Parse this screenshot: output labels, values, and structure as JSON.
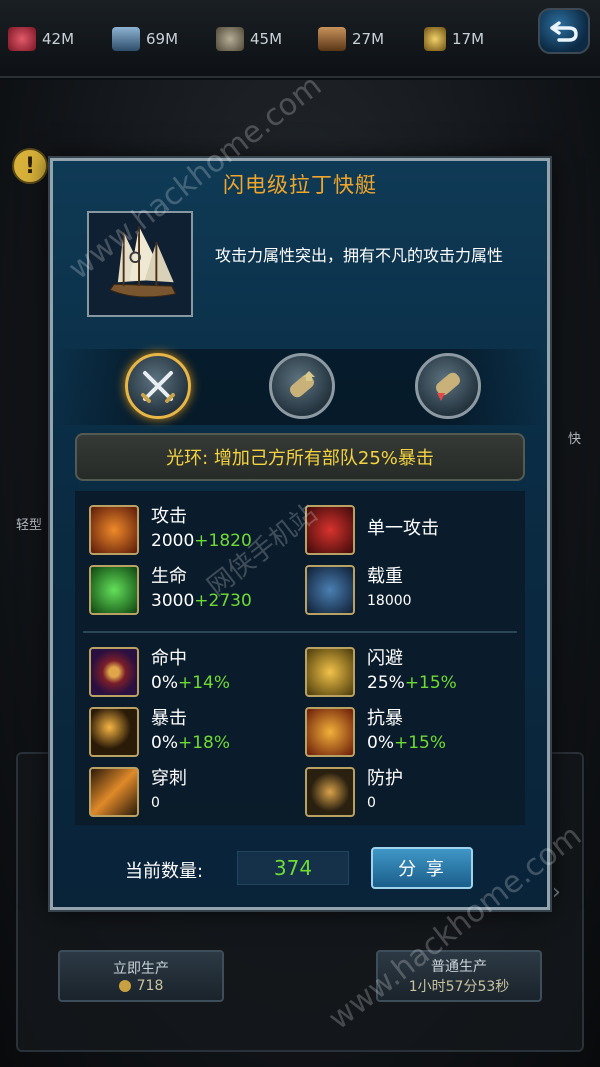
{
  "resources": [
    {
      "icon": "ruby-icon",
      "value": "42M",
      "color": "#c0354a"
    },
    {
      "icon": "steel-icon",
      "value": "69M",
      "color": "#4d7aa3"
    },
    {
      "icon": "stone-icon",
      "value": "45M",
      "color": "#8a7f6b"
    },
    {
      "icon": "wood-icon",
      "value": "27M",
      "color": "#9b6b3a"
    },
    {
      "icon": "gold-figure-icon",
      "value": "17M",
      "color": "#c9a03a"
    }
  ],
  "background": {
    "left_label": "轻型",
    "right_label": "快",
    "instant_btn": {
      "label": "立即生产",
      "cost": "718"
    },
    "normal_btn": {
      "label": "普通生产",
      "time": "1小时57分53秒"
    }
  },
  "dialog": {
    "title": "闪电级拉丁快艇",
    "description": "攻击力属性突出，拥有不凡的攻击力属性",
    "tabs": [
      {
        "icon": "crossed-swords-icon",
        "active": true
      },
      {
        "icon": "scroll-up-icon",
        "active": false
      },
      {
        "icon": "scroll-down-icon",
        "active": false
      }
    ],
    "aura": "光环: 增加己方所有部队25%暴击",
    "stats": [
      {
        "name": "攻击",
        "base": "2000",
        "bonus": "+1820",
        "icon": "attack-icon"
      },
      {
        "name": "单一攻击",
        "base": "",
        "bonus": "",
        "icon": "single-attack-icon"
      },
      {
        "name": "生命",
        "base": "3000",
        "bonus": "+2730",
        "icon": "health-icon"
      },
      {
        "name": "载重",
        "base": "18000",
        "bonus": "",
        "icon": "load-icon"
      },
      {
        "name": "命中",
        "base": "0%",
        "bonus": "+14%",
        "icon": "accuracy-icon"
      },
      {
        "name": "闪避",
        "base": "25%",
        "bonus": "+15%",
        "icon": "dodge-icon"
      },
      {
        "name": "暴击",
        "base": "0%",
        "bonus": "+18%",
        "icon": "critical-icon"
      },
      {
        "name": "抗暴",
        "base": "0%",
        "bonus": "+15%",
        "icon": "crit-resist-icon"
      },
      {
        "name": "穿刺",
        "base": "0",
        "bonus": "",
        "icon": "pierce-icon"
      },
      {
        "name": "防护",
        "base": "0",
        "bonus": "",
        "icon": "protection-icon"
      }
    ],
    "count_label": "当前数量:",
    "count_value": "374",
    "share_label": "分 享"
  },
  "watermarks": [
    "www.hackhome.com",
    "网侠手机站",
    "www.hackhome.com"
  ]
}
